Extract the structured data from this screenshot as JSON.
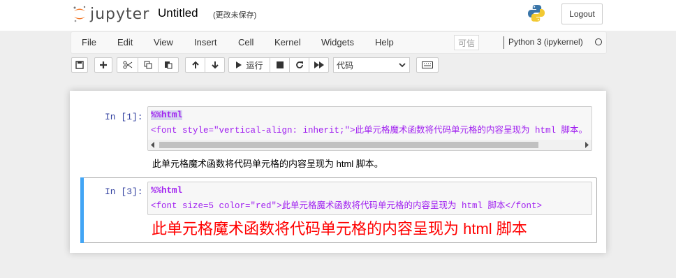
{
  "header": {
    "logo_text": "jupyter",
    "title": "Untitled",
    "status": "(更改未保存)",
    "logout_label": "Logout"
  },
  "menubar": {
    "items": [
      "File",
      "Edit",
      "View",
      "Insert",
      "Cell",
      "Kernel",
      "Widgets",
      "Help"
    ],
    "trusted_label": "可信",
    "kernel_name": "Python 3 (ipykernel)"
  },
  "toolbar": {
    "run_label": "运行",
    "cell_type": "代码"
  },
  "cells": [
    {
      "prompt": "In  [1]:",
      "code_lines": [
        "%%html",
        "<font style=\"vertical-align: inherit;\">此单元格魔术函数将代码单元格的内容呈现为 html 脚本。"
      ],
      "output": "此单元格魔术函数将代码单元格的内容呈现为 html 脚本。"
    },
    {
      "prompt": "In  [3]:",
      "code_lines": [
        "%%html",
        "<font size=5 color=\"red\">此单元格魔术函数将代码单元格的内容呈现为 html 脚本</font>"
      ],
      "output": "此单元格魔术函数将代码单元格的内容呈现为 html 脚本",
      "output_color": "#ff0000"
    }
  ]
}
